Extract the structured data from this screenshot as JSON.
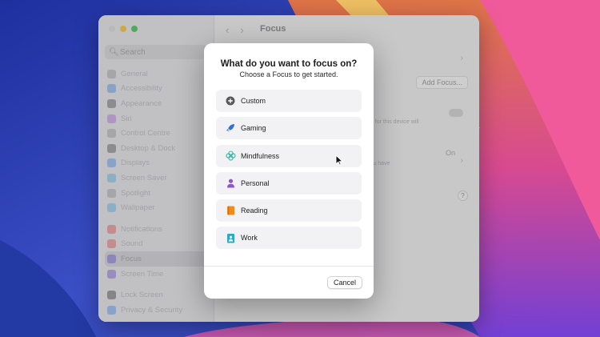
{
  "window": {
    "title": "Focus",
    "search_placeholder": "Search",
    "sidebar_items": [
      {
        "label": "General",
        "icon": "gear-icon",
        "color": "#9a9a9e"
      },
      {
        "label": "Accessibility",
        "icon": "accessibility-icon",
        "color": "#4f8ff0"
      },
      {
        "label": "Appearance",
        "icon": "appearance-icon",
        "color": "#555"
      },
      {
        "label": "Siri",
        "icon": "siri-icon",
        "color": "#b26de0"
      },
      {
        "label": "Control Centre",
        "icon": "control-centre-icon",
        "color": "#9a9a9e"
      },
      {
        "label": "Desktop & Dock",
        "icon": "dock-icon",
        "color": "#555"
      },
      {
        "label": "Displays",
        "icon": "displays-icon",
        "color": "#4f8ff0"
      },
      {
        "label": "Screen Saver",
        "icon": "screen-saver-icon",
        "color": "#56b4e8"
      },
      {
        "label": "Spotlight",
        "icon": "spotlight-icon",
        "color": "#9a9a9e"
      },
      {
        "label": "Wallpaper",
        "icon": "wallpaper-icon",
        "color": "#56b4e8"
      }
    ],
    "sidebar_items_2": [
      {
        "label": "Notifications",
        "icon": "notifications-icon",
        "color": "#ee5555"
      },
      {
        "label": "Sound",
        "icon": "sound-icon",
        "color": "#ee5555"
      },
      {
        "label": "Focus",
        "icon": "focus-icon",
        "color": "#6a5ad8",
        "selected": true
      },
      {
        "label": "Screen Time",
        "icon": "screen-time-icon",
        "color": "#7a5ad8"
      }
    ],
    "sidebar_items_3": [
      {
        "label": "Lock Screen",
        "icon": "lock-icon",
        "color": "#444"
      },
      {
        "label": "Privacy & Security",
        "icon": "privacy-icon",
        "color": "#4f8ff0"
      }
    ],
    "add_focus_label": "Add Focus...",
    "share_text": "on for this device will",
    "status_on": "On",
    "status_text": "you have",
    "help_label": "?"
  },
  "modal": {
    "title": "What do you want to focus on?",
    "subtitle": "Choose a Focus to get started.",
    "options": [
      {
        "label": "Custom",
        "icon": "plus-circle-icon",
        "color": "#555558"
      },
      {
        "label": "Gaming",
        "icon": "rocket-icon",
        "color": "#2f6fe0"
      },
      {
        "label": "Mindfulness",
        "icon": "flower-icon",
        "color": "#34b8a8"
      },
      {
        "label": "Personal",
        "icon": "person-icon",
        "color": "#8a58c8"
      },
      {
        "label": "Reading",
        "icon": "book-icon",
        "color": "#ef8b1e"
      },
      {
        "label": "Work",
        "icon": "badge-icon",
        "color": "#2aa8c8"
      }
    ],
    "cancel_label": "Cancel"
  }
}
